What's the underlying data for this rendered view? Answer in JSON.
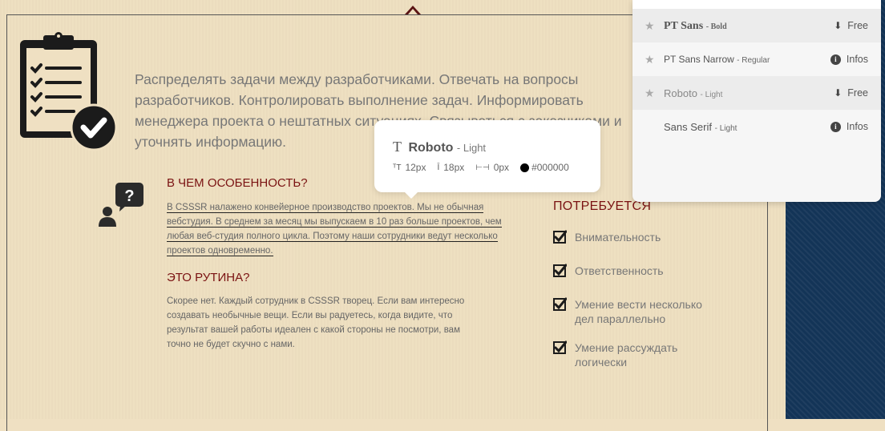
{
  "intro": "Распределять задачи между разработчиками. Отвечать на вопросы разработчиков. Контролировать выполнение задач. Информировать менеджера проекта о нештатных ситуациях. Связываться с заказчиками и уточнять информацию.",
  "features": {
    "heading": "В ЧЕМ ОСОБЕННОСТЬ?",
    "text": "В CSSSR налажено конвейерное производство проектов. Мы не обычная вебстудия. В среднем за месяц мы выпускаем в 10 раз больше проектов, чем любая веб-студия полного цикла. Поэтому наши сотрудники ведут несколько проектов одновременно."
  },
  "routine": {
    "heading": "ЭТО РУТИНА?",
    "text": "Скорее нет. Каждый сотрудник в CSSSR творец. Если вам интересно создавать необычные вещи. Если вы радуетесь, когда видите, что результат вашей работы идеален с какой стороны не посмотри, вам точно не будет скучно с нами."
  },
  "requirements": {
    "heading": "ПОТРЕБУЕТСЯ",
    "items": [
      {
        "label": "Внимательность",
        "checked": true
      },
      {
        "label": "Ответственность",
        "checked": true
      },
      {
        "label": "Умение вести несколько дел параллельно",
        "checked": true
      },
      {
        "label": "Умение рассуждать логически",
        "checked": true
      }
    ]
  },
  "font_popup": {
    "font_name": "Roboto",
    "style": "Light",
    "font_size": "12px",
    "line_height": "18px",
    "letter_spacing": "0px",
    "color": "#000000"
  },
  "font_panel": {
    "fonts": [
      {
        "name": "PT Sans",
        "style": "Bold",
        "action": "Free",
        "action_icon": "download-icon",
        "starred": true
      },
      {
        "name": "PT Sans Narrow",
        "style": "Regular",
        "action": "Infos",
        "action_icon": "info-icon",
        "starred": true
      },
      {
        "name": "Roboto",
        "style": "Light",
        "action": "Free",
        "action_icon": "download-icon",
        "starred": true
      },
      {
        "name": "Sans Serif",
        "style": "Light",
        "action": "Infos",
        "action_icon": "info-icon",
        "starred": false
      }
    ]
  },
  "colors": {
    "accent": "#7a1212",
    "background": "#eedfc0",
    "side": "#133457"
  }
}
